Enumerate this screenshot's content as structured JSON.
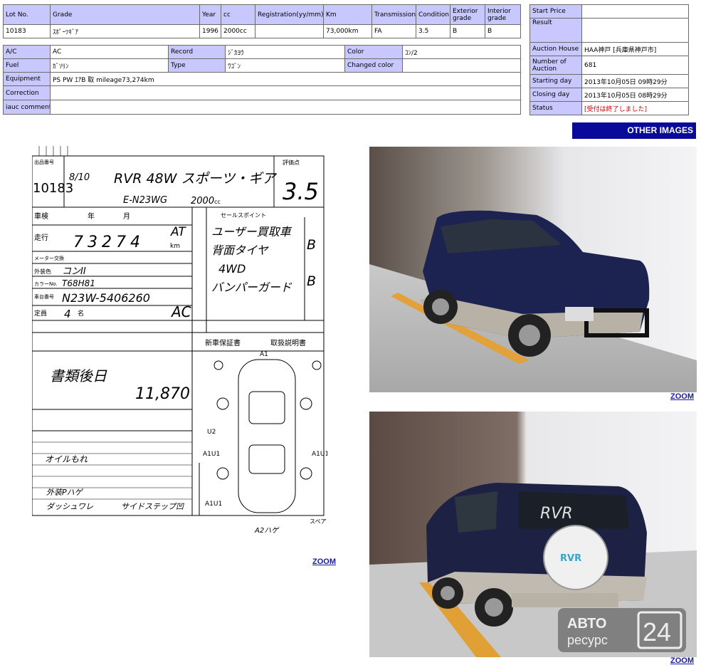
{
  "lot_table": {
    "headers": [
      "Lot No.",
      "Grade",
      "Year",
      "cc",
      "Registration(yy/mm)",
      "Km",
      "Transmission",
      "Condition",
      "Exterior grade",
      "Interior grade"
    ],
    "values": [
      "10183",
      "ｽﾎﾟｰﾂｷﾞｱ",
      "1996",
      "2000cc",
      "",
      "73,000km",
      "FA",
      "3.5",
      "B",
      "B"
    ]
  },
  "detail_table": {
    "ac_label": "A/C",
    "ac_value": "AC",
    "record_label": "Record",
    "record_value": "ｼﾞｶﾖｳ",
    "color_label": "Color",
    "color_value": "ｺﾝ/2",
    "fuel_label": "Fuel",
    "fuel_value": "ｶﾞｿﾘﾝ",
    "type_label": "Type",
    "type_value": "ﾜｺﾞﾝ",
    "changed_color_label": "Changed color",
    "changed_color_value": "",
    "equipment_label": "Equipment",
    "equipment_value": "PS PW ｴｱB 取 mileage73,274km",
    "correction_label": "Correction",
    "correction_value": "",
    "iauc_label": "iauc comment",
    "iauc_value": ""
  },
  "side_table": {
    "start_price_label": "Start Price",
    "start_price_value": "",
    "result_label": "Result",
    "result_value": "",
    "auction_house_label": "Auction House",
    "auction_house_value": "HAA神戸 [兵庫県神戸市]",
    "number_label": "Number of Auction",
    "number_value": "681",
    "starting_label": "Starting day",
    "starting_value": "2013年10月05日 09時29分",
    "closing_label": "Closing day",
    "closing_value": "2013年10月05日 08時29分",
    "status_label": "Status",
    "status_value": "[受付は終了しました]"
  },
  "buttons": {
    "other_images": "OTHER IMAGES",
    "zoom": "ZOOM"
  },
  "sheet": {
    "lot_label": "出品番号",
    "lot": "10183",
    "date": "8/10",
    "title": "RVR 48W スポーツ・ギア",
    "model": "E-N23WG",
    "cc": "2000",
    "cc_unit": "cc",
    "score_label": "評価点",
    "score": "3.5",
    "shaken_label": "車検",
    "year_label": "年",
    "month_label": "月",
    "mileage_label": "走行",
    "mileage": "73274",
    "km": "km",
    "meter_label": "メーター交換",
    "exterior_label": "外装色",
    "exterior": "コンII",
    "color_no_label": "カラーNo.",
    "color_no": "T68H81",
    "frame_label": "車台番号",
    "frame": "N23W-5406260",
    "capacity_label": "定員",
    "capacity": "4",
    "capacity_unit": "名",
    "seller_points": "セールスポイント",
    "points": [
      "ユーザー買取車",
      "背面タイヤ",
      "4WD",
      "バンパーガード"
    ],
    "grades": [
      "B",
      "B"
    ],
    "at": "AT",
    "ac": "AC",
    "warranty": "新車保証書",
    "manual": "取扱説明書",
    "note_big": "書類後日",
    "recycle": "11,870",
    "remarks": [
      "オイルもれ",
      "外装Pハゲ",
      "ダッシュワレ",
      "サイドステップ凹"
    ],
    "diagram_marks": [
      "A1",
      "U2",
      "A1U1",
      "A1U1",
      "A1U1",
      "A2ハゲ"
    ],
    "spare": "スペア"
  },
  "photos": {
    "front_plate_badge": "",
    "rear_spare_text": "RVR",
    "watermark_top": "АВТО",
    "watermark_bottom": "ресурс",
    "watermark_number": "24"
  }
}
